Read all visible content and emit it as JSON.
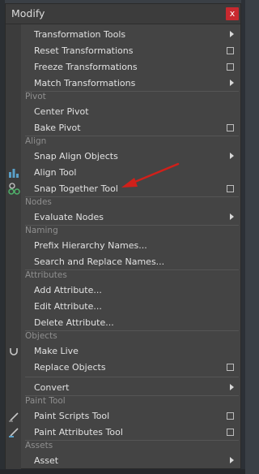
{
  "window": {
    "title": "Modify",
    "close_label": "x"
  },
  "rows": [
    {
      "label": "Transformation Tools",
      "indicator": "submenu"
    },
    {
      "label": "Reset Transformations",
      "indicator": "option-box"
    },
    {
      "label": "Freeze Transformations",
      "indicator": "option-box"
    },
    {
      "label": "Match Transformations",
      "indicator": "submenu"
    },
    {
      "label": "Center Pivot",
      "indicator": "none"
    },
    {
      "label": "Bake Pivot",
      "indicator": "option-box"
    },
    {
      "label": "Snap Align Objects",
      "indicator": "submenu"
    },
    {
      "label": "Align Tool",
      "indicator": "none"
    },
    {
      "label": "Snap Together Tool",
      "indicator": "option-box"
    },
    {
      "label": "Evaluate Nodes",
      "indicator": "submenu"
    },
    {
      "label": "Prefix Hierarchy Names...",
      "indicator": "none"
    },
    {
      "label": "Search and Replace Names...",
      "indicator": "none"
    },
    {
      "label": "Add Attribute...",
      "indicator": "none"
    },
    {
      "label": "Edit Attribute...",
      "indicator": "none"
    },
    {
      "label": "Delete Attribute...",
      "indicator": "none"
    },
    {
      "label": "Make Live",
      "indicator": "none"
    },
    {
      "label": "Replace Objects",
      "indicator": "option-box"
    },
    {
      "label": "Convert",
      "indicator": "submenu"
    },
    {
      "label": "Paint Scripts Tool",
      "indicator": "option-box"
    },
    {
      "label": "Paint Attributes Tool",
      "indicator": "option-box"
    },
    {
      "label": "Asset",
      "indicator": "submenu"
    }
  ],
  "sections": [
    "Pivot",
    "Align",
    "Nodes",
    "Naming",
    "Attributes",
    "Objects",
    "Paint Tool",
    "Assets"
  ],
  "icons": {
    "align_tool": "align-tool-icon",
    "snap_together": "snap-together-icon",
    "make_live": "magnet-icon",
    "paint_scripts": "paint-brush-icon",
    "paint_attributes": "paint-attributes-icon"
  },
  "annotation": {
    "type": "red-arrow",
    "color": "#d0201a",
    "points_to": "Snap Together Tool"
  },
  "colors": {
    "menu_bg": "#444444",
    "text": "#e2e2e2",
    "section_text": "#8f8f8f",
    "close_bg": "#c8292f"
  }
}
